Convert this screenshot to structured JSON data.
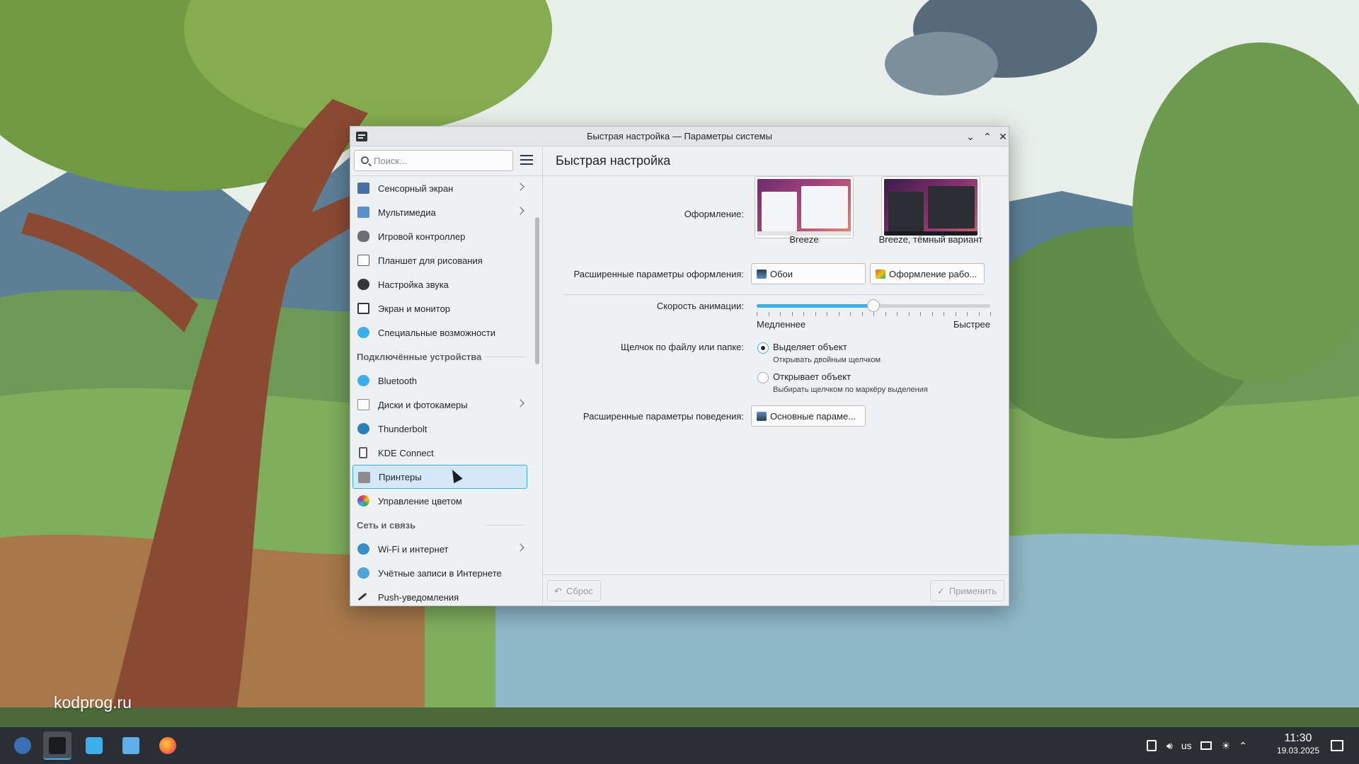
{
  "window": {
    "title": "Быстрая настройка — Параметры системы",
    "minimize_glyph": "⌄",
    "maximize_glyph": "⌃",
    "close_glyph": "✕"
  },
  "search": {
    "placeholder": "Поиск..."
  },
  "sidebar": {
    "items_top": [
      {
        "label": "Сенсорный экран",
        "icon": "touchscreen-icon",
        "has_children": true
      },
      {
        "label": "Мультимедиа",
        "icon": "multimedia-icon",
        "has_children": true
      },
      {
        "label": "Игровой контроллер",
        "icon": "gamepad-icon",
        "has_children": false
      },
      {
        "label": "Планшет для рисования",
        "icon": "drawing-tablet-icon",
        "has_children": false
      },
      {
        "label": "Настройка звука",
        "icon": "sound-icon",
        "has_children": false
      },
      {
        "label": "Экран и монитор",
        "icon": "monitor-icon",
        "has_children": false
      },
      {
        "label": "Специальные возможности",
        "icon": "accessibility-icon",
        "has_children": false
      }
    ],
    "section_devices": "Подключённые устройства",
    "items_devices": [
      {
        "label": "Bluetooth",
        "icon": "bluetooth-icon",
        "has_children": false
      },
      {
        "label": "Диски и фотокамеры",
        "icon": "disks-icon",
        "has_children": true
      },
      {
        "label": "Thunderbolt",
        "icon": "thunderbolt-icon",
        "has_children": false
      },
      {
        "label": "KDE Connect",
        "icon": "kde-connect-icon",
        "has_children": false
      },
      {
        "label": "Принтеры",
        "icon": "printer-icon",
        "has_children": false,
        "selected": true
      },
      {
        "label": "Управление цветом",
        "icon": "color-management-icon",
        "has_children": false
      }
    ],
    "section_network": "Сеть и связь",
    "items_network": [
      {
        "label": "Wi-Fi и интернет",
        "icon": "wifi-icon",
        "has_children": true
      },
      {
        "label": "Учётные записи в Интернете",
        "icon": "online-accounts-icon",
        "has_children": false
      },
      {
        "label": "Push-уведомления",
        "icon": "push-notifications-icon",
        "has_children": false
      }
    ]
  },
  "main": {
    "header": "Быстрая настройка",
    "appearance_label": "Оформление:",
    "theme_light": "Breeze",
    "theme_dark": "Breeze, тёмный вариант",
    "advanced_appearance_label": "Расширенные параметры оформления:",
    "wallpaper_button": "Обои",
    "workspace_theme_button": "Оформление рабо...",
    "animation_label": "Скорость анимации:",
    "animation_value": 0.5,
    "slower": "Медленнее",
    "faster": "Быстрее",
    "click_label": "Щелчок по файлу или папке:",
    "option_select": "Выделяет объект",
    "option_select_hint": "Открывать двойным щелчком",
    "option_open": "Открывает объект",
    "option_open_hint": "Выбирать щелчком по маркёру выделения",
    "advanced_behavior_label": "Расширенные параметры поведения:",
    "behavior_button": "Основные параме...",
    "reset_button": "Сброс",
    "apply_button": "Применить"
  },
  "desktop": {
    "watermark": "kodprog.ru"
  },
  "taskbar": {
    "keyboard_layout": "us",
    "time": "11:30",
    "date": "19.03.2025"
  },
  "colors": {
    "accent": "#3daee9",
    "window_bg": "#eff0f1",
    "taskbar_bg": "#2b2e33"
  }
}
